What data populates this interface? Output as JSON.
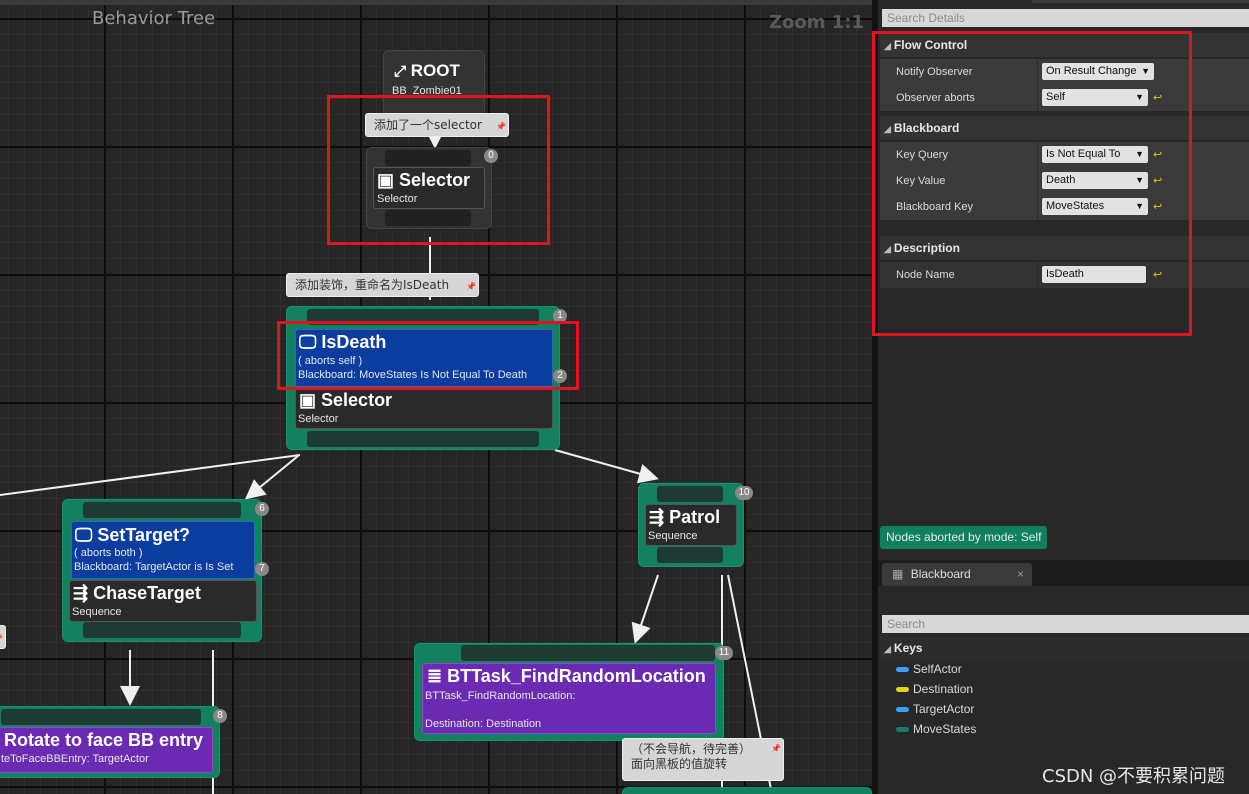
{
  "graph": {
    "title": "Behavior Tree",
    "zoom": "Zoom 1:1",
    "comments": {
      "c1": "添加了一个selector",
      "c2": "添加装饰，重命名为IsDeath",
      "c3_l1": "（不会导航，待完善）",
      "c3_l2": "面向黑板的值旋转"
    },
    "root": {
      "title": "ROOT",
      "subtitle": "BB_Zombie01"
    },
    "selector0": {
      "title": "Selector",
      "subtitle": "Selector",
      "badge": "0"
    },
    "isdeath": {
      "title": "IsDeath",
      "line1": "( aborts self )",
      "line2": "Blackboard: MoveStates Is Not Equal To Death",
      "badge": "2"
    },
    "selector1": {
      "title": "Selector",
      "subtitle": "Selector",
      "badge": "1"
    },
    "settarget": {
      "title": "SetTarget?",
      "line1": "( aborts both )",
      "line2": "Blackboard: TargetActor is Is Set",
      "badge": "7"
    },
    "chasetarget": {
      "title": "ChaseTarget",
      "subtitle": "Sequence",
      "badge": "6"
    },
    "patrol": {
      "title": "Patrol",
      "subtitle": "Sequence",
      "badge": "10"
    },
    "findrandom": {
      "title": "BTTask_FindRandomLocation",
      "line1": "BTTask_FindRandomLocation:",
      "line2": "Destination: Destination",
      "badge": "11"
    },
    "rotate": {
      "title": "Rotate to face BB entry",
      "subtitle": "teToFaceBBEntry: TargetActor",
      "badge": "8"
    }
  },
  "details": {
    "search_placeholder": "Search Details",
    "flow_control": {
      "header": "Flow Control",
      "notify_label": "Notify Observer",
      "notify_value": "On Result Change",
      "aborts_label": "Observer aborts",
      "aborts_value": "Self"
    },
    "blackboard": {
      "header": "Blackboard",
      "query_label": "Key Query",
      "query_value": "Is Not Equal To",
      "value_label": "Key Value",
      "value_value": "Death",
      "key_label": "Blackboard Key",
      "key_value": "MoveStates"
    },
    "description": {
      "header": "Description",
      "name_label": "Node Name",
      "name_value": "IsDeath"
    },
    "note": "Nodes aborted by mode: Self"
  },
  "blackboard_panel": {
    "tab_label": "Blackboard",
    "close": "×",
    "search_placeholder": "Search",
    "keys_header": "Keys",
    "keys": [
      {
        "name": "SelfActor",
        "color": "#3aa0ff"
      },
      {
        "name": "Destination",
        "color": "#e8d020"
      },
      {
        "name": "TargetActor",
        "color": "#3aa0ff"
      },
      {
        "name": "MoveStates",
        "color": "#1a7a6a"
      }
    ]
  },
  "watermark": "CSDN @不要积累问题"
}
